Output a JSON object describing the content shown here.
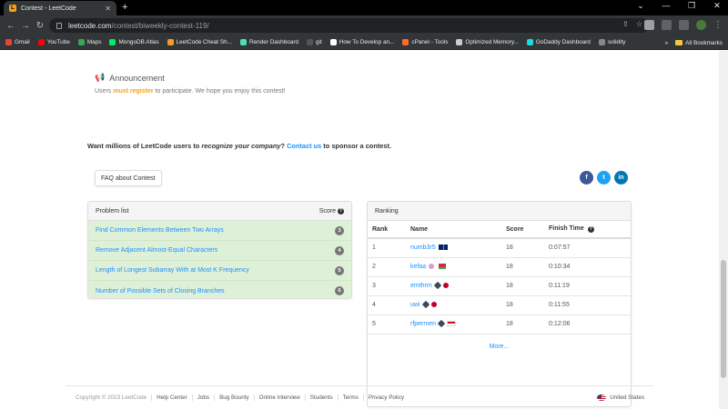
{
  "browser": {
    "tab_title": "Contest - LeetCode",
    "new_tab": "+",
    "url_host": "leetcode.com",
    "url_path": "/contest/biweekly-contest-119/",
    "bookmarks": [
      {
        "label": "Gmail",
        "color": "#ea4335"
      },
      {
        "label": "YouTube",
        "color": "#ff0000"
      },
      {
        "label": "Maps",
        "color": "#34a853"
      },
      {
        "label": "MongoDB Atlas",
        "color": "#00ed64"
      },
      {
        "label": "LeetCode Cheat Sh...",
        "color": "#f89f1b"
      },
      {
        "label": "Render Dashboard",
        "color": "#46e3b7"
      },
      {
        "label": "git",
        "color": "#555555"
      },
      {
        "label": "How To Develop an...",
        "color": "#ffffff"
      },
      {
        "label": "cPanel - Tools",
        "color": "#ff6c2c"
      },
      {
        "label": "Optimized Memory...",
        "color": "#cccccc"
      },
      {
        "label": "GoDaddy Dashboard",
        "color": "#1bdbdb"
      },
      {
        "label": "solidity",
        "color": "#888888"
      }
    ],
    "all_bookmarks": "All Bookmarks"
  },
  "announcement": {
    "title": "Announcement",
    "text_before": "Users ",
    "must_register": "must register",
    "text_after": " to participate. We hope you enjoy this contest!"
  },
  "sponsor": {
    "before": "Want millions of LeetCode users to ",
    "italic": "recognize your company",
    "middle": "? ",
    "contact": "Contact us",
    "after": " to sponsor a contest."
  },
  "faq_button": "FAQ about Contest",
  "social": {
    "facebook": "f",
    "twitter": "t",
    "linkedin": "in"
  },
  "problem_list": {
    "header": "Problem list",
    "score_header": "Score",
    "items": [
      {
        "name": "Find Common Elements Between Two Arrays",
        "score": "3"
      },
      {
        "name": "Remove Adjacent Almost-Equal Characters",
        "score": "4"
      },
      {
        "name": "Length of Longest Subarray With at Most K Frequency",
        "score": "5"
      },
      {
        "name": "Number of Possible Sets of Closing Branches",
        "score": "6"
      }
    ]
  },
  "ranking": {
    "header": "Ranking",
    "columns": [
      "Rank",
      "Name",
      "Score",
      "Finish Time"
    ],
    "rows": [
      {
        "rank": "1",
        "name": "numb3r5",
        "score": "18",
        "time": "0:07:57"
      },
      {
        "rank": "2",
        "name": "kefaa",
        "score": "18",
        "time": "0:10:34"
      },
      {
        "rank": "3",
        "name": "emthrm",
        "score": "18",
        "time": "0:11:19"
      },
      {
        "rank": "4",
        "name": "uwi",
        "score": "18",
        "time": "0:11:55"
      },
      {
        "rank": "5",
        "name": "rfpermen",
        "score": "18",
        "time": "0:12:06"
      }
    ],
    "more": "More..."
  },
  "footer": {
    "copyright": "Copyright © 2023 LeetCode",
    "links": [
      "Help Center",
      "Jobs",
      "Bug Bounty",
      "Online Interview",
      "Students",
      "Terms",
      "Privacy Policy"
    ],
    "region": "United States"
  }
}
